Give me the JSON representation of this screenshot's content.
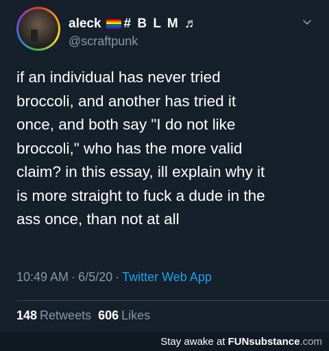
{
  "tweet": {
    "display_name": "aleck",
    "name_suffix": "# B L M ♬",
    "flag_icon": "rainbow-flag-icon",
    "handle": "@scraftpunk",
    "body": "if an individual has never tried\nbroccoli, and another has tried it\nonce, and both say \"I do not like\nbroccoli,\" who has the more valid\nclaim? in this essay, ill explain why it\nis more straight to fuck a dude in the\nass once, than not at all",
    "time": "10:49 AM",
    "date": "6/5/20",
    "source": "Twitter Web App",
    "separator": "·",
    "retweets_count": "148",
    "retweets_label": "Retweets",
    "likes_count": "606",
    "likes_label": "Likes",
    "menu_icon": "chevron-down-icon"
  },
  "watermark": {
    "prefix": "Stay awake at",
    "brand_a": "FUN",
    "brand_b": "substance",
    "brand_c": ".com"
  },
  "colors": {
    "background": "#15202b",
    "text": "#ffffff",
    "muted": "#8899a6",
    "link": "#1da1f2"
  }
}
